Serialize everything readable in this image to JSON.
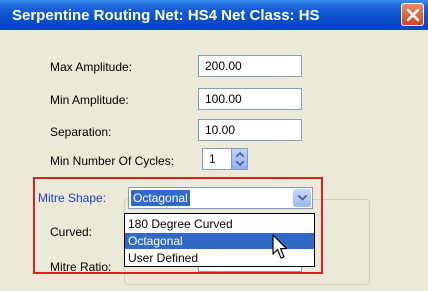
{
  "window": {
    "title": "Serpentine Routing Net: HS4 Net Class: HS"
  },
  "fields": {
    "max_amplitude": {
      "label": "Max Amplitude:",
      "value": "200.00"
    },
    "min_amplitude": {
      "label": "Min Amplitude:",
      "value": "100.00"
    },
    "separation": {
      "label": "Separation:",
      "value": "10.00"
    },
    "min_cycles": {
      "label": "Min Number Of Cycles:",
      "value": "1"
    }
  },
  "mitre": {
    "shape_label": "Mitre Shape:",
    "shape_value": "Octagonal",
    "options": [
      "180 Degree Curved",
      "Octagonal",
      "User Defined"
    ],
    "selected_index": 1,
    "curved_label": "Curved:",
    "ratio_label": "Mitre Ratio:"
  },
  "colors": {
    "highlight_box": "#e0201b",
    "selection": "#316ac5",
    "mitre_label": "#1a3fd0"
  },
  "icons": [
    "close-icon",
    "spin-up-icon",
    "spin-down-icon",
    "chevron-down-icon",
    "mouse-cursor-icon"
  ]
}
